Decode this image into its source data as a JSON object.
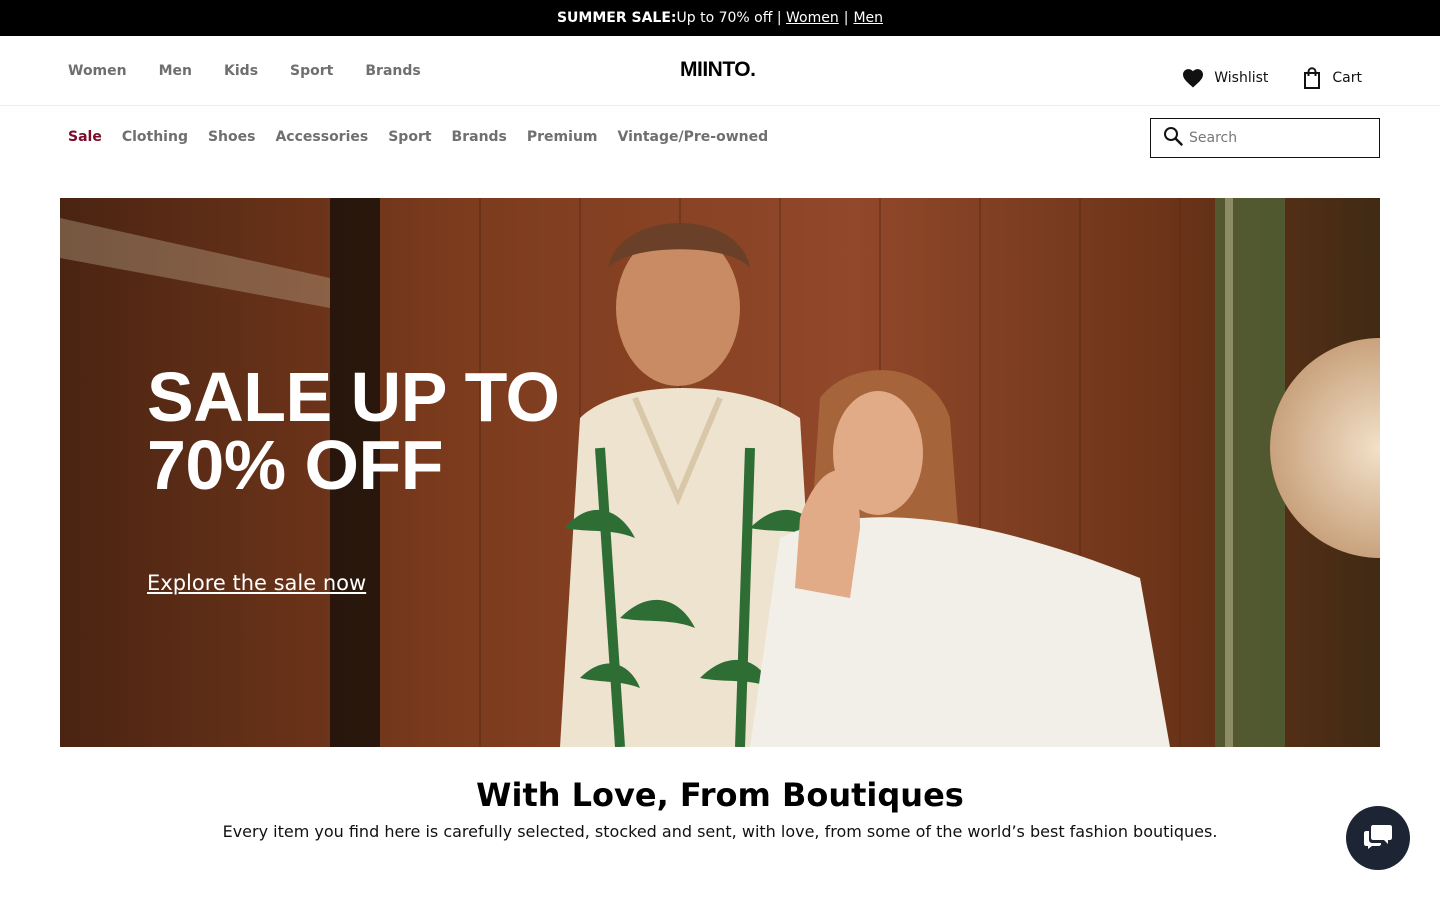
{
  "promo": {
    "label": "SUMMER SALE:",
    "text": " Up to 70% off |",
    "links": [
      "Women",
      "Men"
    ],
    "separator": "|"
  },
  "header": {
    "gender_nav": [
      "Women",
      "Men",
      "Kids",
      "Sport",
      "Brands"
    ],
    "logo": "MIINTO.",
    "wishlist_label": "Wishlist",
    "wishlist_icon": "heart-icon",
    "cart_label": "Cart",
    "cart_icon": "shopping-bag-icon"
  },
  "category_nav": {
    "items": [
      "Sale",
      "Clothing",
      "Shoes",
      "Accessories",
      "Sport",
      "Brands",
      "Premium",
      "Vintage/Pre-owned"
    ],
    "sale_color": "#7a0d2a"
  },
  "search": {
    "placeholder": "Search",
    "icon": "search-icon"
  },
  "hero": {
    "title_line1": "SALE UP TO",
    "title_line2": "70% OFF",
    "cta": "Explore the sale now"
  },
  "section": {
    "title": "With Love, From Boutiques",
    "subtitle": "Every item you find here is carefully selected, stocked and sent, with love, from some of the world’s best fashion boutiques."
  },
  "chat": {
    "icon": "chat-bubbles-icon",
    "color": "#1d2433"
  }
}
